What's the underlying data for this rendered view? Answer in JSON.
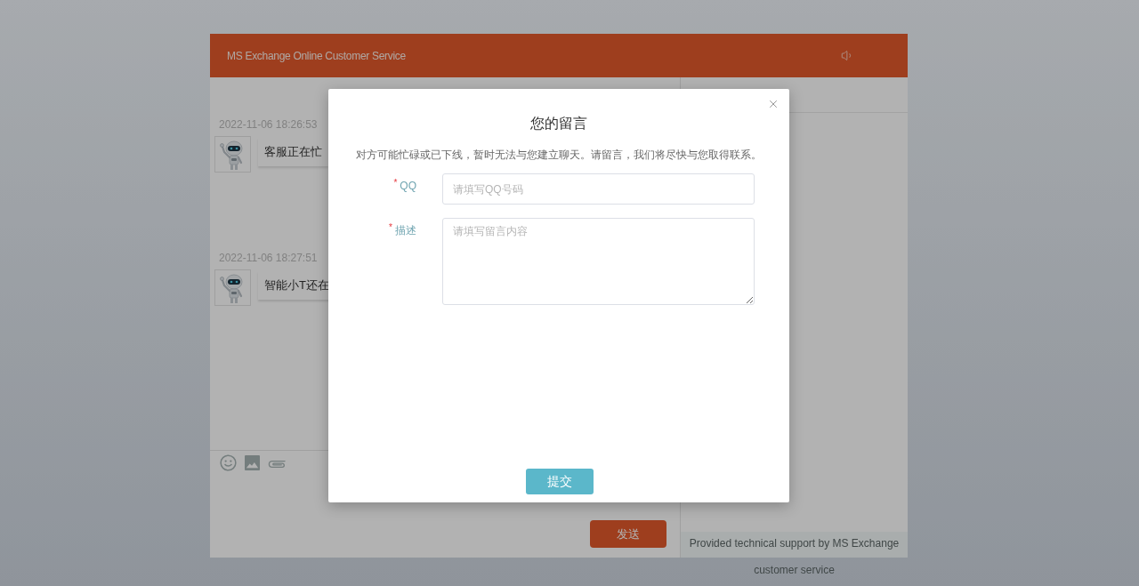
{
  "window": {
    "title": "MS Exchange Online Customer Service"
  },
  "messages": [
    {
      "time": "2022-11-06 18:26:53",
      "text": "客服正在忙"
    },
    {
      "time": "2022-11-06 18:27:51",
      "text": "智能小T还在"
    }
  ],
  "send_button": "发送",
  "footer": "Provided technical support by MS Exchange customer service",
  "dialog": {
    "title": "您的留言",
    "description": "对方可能忙碌或已下线，暂时无法与您建立聊天。请留言，我们将尽快与您取得联系。",
    "fields": [
      {
        "kind": "input",
        "required_mark": "*",
        "label": "QQ",
        "placeholder": "请填写QQ号码"
      },
      {
        "kind": "textarea",
        "required_mark": "*",
        "label": "描述",
        "placeholder": "请填写留言内容"
      }
    ],
    "submit_button": "提交"
  }
}
